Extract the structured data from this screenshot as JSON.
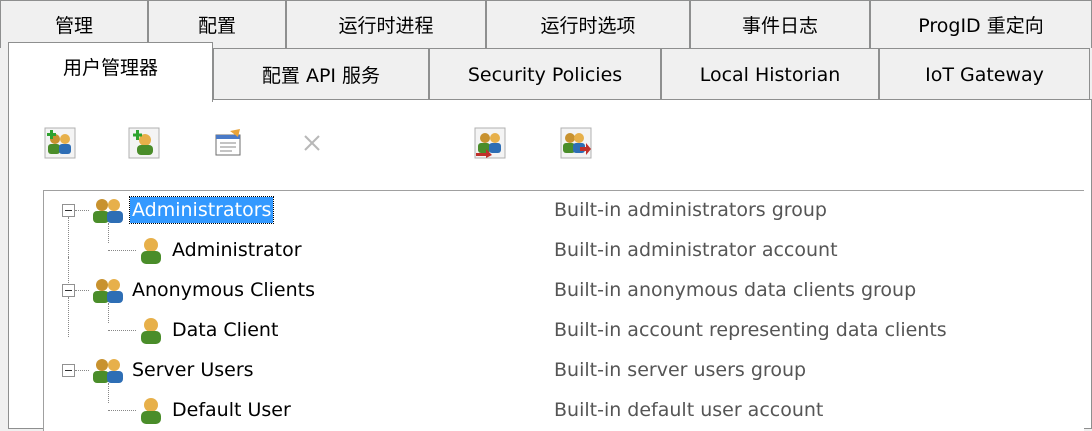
{
  "tabs_back": [
    {
      "label": "管理"
    },
    {
      "label": "配置"
    },
    {
      "label": "运行时进程"
    },
    {
      "label": "运行时选项"
    },
    {
      "label": "事件日志"
    },
    {
      "label": "ProgID 重定向"
    }
  ],
  "tabs_front": [
    {
      "label": "用户管理器",
      "active": true
    },
    {
      "label": "配置 API 服务"
    },
    {
      "label": "Security Policies"
    },
    {
      "label": "Local Historian"
    },
    {
      "label": "IoT Gateway"
    }
  ],
  "toolbar": [
    {
      "icon": "add-user-group-icon",
      "enabled": true
    },
    {
      "icon": "add-user-icon",
      "enabled": true
    },
    {
      "icon": "properties-icon",
      "enabled": true
    },
    {
      "icon": "delete-icon",
      "enabled": false
    },
    {
      "icon": "import-users-icon",
      "enabled": true
    },
    {
      "icon": "export-users-icon",
      "enabled": true
    }
  ],
  "tree": [
    {
      "name": "Administrators",
      "description": "Built-in administrators group",
      "type": "group",
      "selected": true
    },
    {
      "name": "Administrator",
      "description": "Built-in administrator account",
      "type": "user"
    },
    {
      "name": "Anonymous Clients",
      "description": "Built-in anonymous data clients group",
      "type": "group"
    },
    {
      "name": "Data Client",
      "description": "Built-in account representing data clients",
      "type": "user"
    },
    {
      "name": "Server Users",
      "description": "Built-in server users group",
      "type": "group"
    },
    {
      "name": "Default User",
      "description": "Built-in default user account",
      "type": "user"
    }
  ],
  "colors": {
    "selection": "#3399ff",
    "description_text": "#555555"
  }
}
